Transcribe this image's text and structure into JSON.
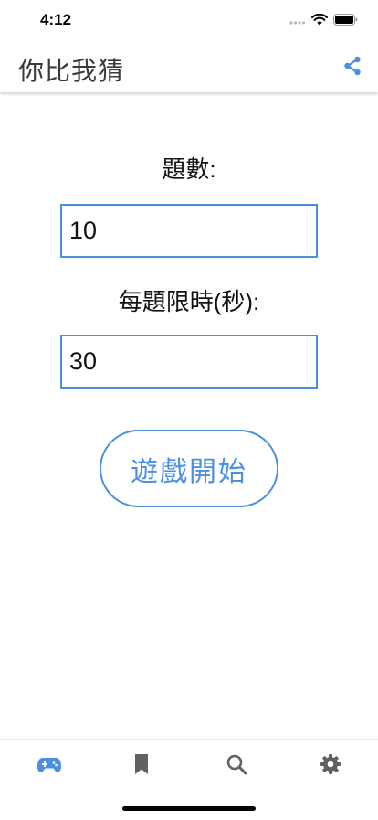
{
  "status_bar": {
    "time": "4:12"
  },
  "app_bar": {
    "title": "你比我猜",
    "share_icon": "share-icon"
  },
  "form": {
    "question_count_label": "題數:",
    "question_count_value": "10",
    "time_limit_label": "每題限時(秒):",
    "time_limit_value": "30",
    "start_button_label": "遊戲開始"
  },
  "tabs": [
    {
      "icon": "gamepad-icon",
      "active": true
    },
    {
      "icon": "bookmark-icon",
      "active": false
    },
    {
      "icon": "search-icon",
      "active": false
    },
    {
      "icon": "gear-icon",
      "active": false
    }
  ],
  "colors": {
    "accent": "#4a8fe2",
    "inactive_icon": "#616161",
    "title_text": "#3a3a3a"
  }
}
